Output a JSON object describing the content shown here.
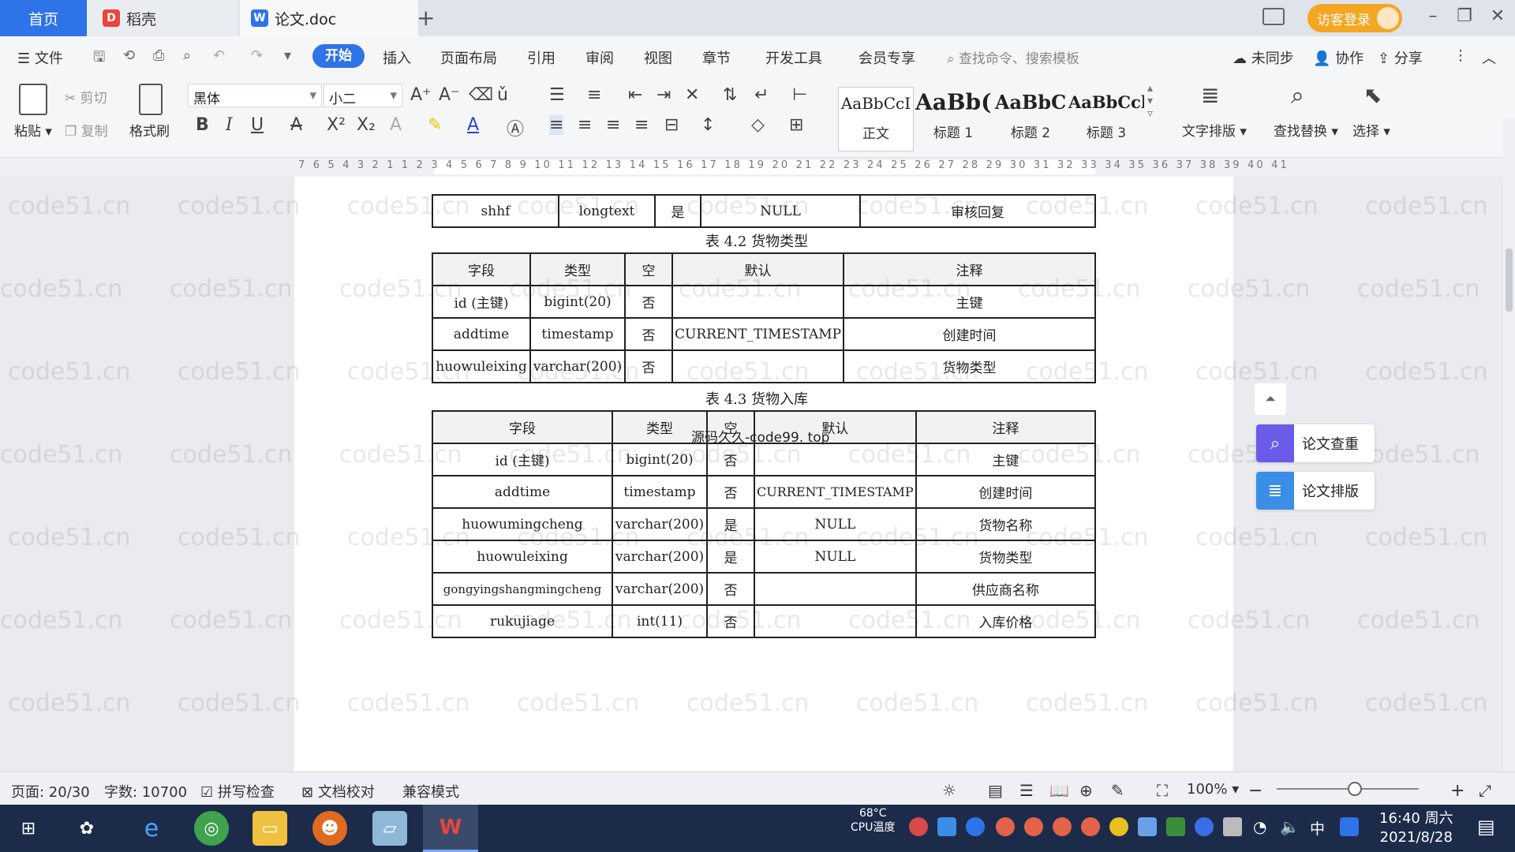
{
  "titlebar": {
    "tabs": [
      {
        "label": "首页"
      },
      {
        "label": "稻壳",
        "icon": "daoke-icon"
      },
      {
        "label": "论文.doc",
        "icon": "wps-writer-icon"
      }
    ],
    "guest_login": "访客登录"
  },
  "menubar": {
    "file": "文件",
    "items": [
      "开始",
      "插入",
      "页面布局",
      "引用",
      "审阅",
      "视图",
      "章节",
      "开发工具",
      "会员专享"
    ],
    "search_placeholder": "查找命令、搜索模板",
    "unsynced": "未同步",
    "collaborate": "协作",
    "share": "分享"
  },
  "ribbon": {
    "paste": "粘贴",
    "cut": "剪切",
    "copy": "复制",
    "format_painter": "格式刷",
    "font_name": "黑体",
    "font_size": "小二",
    "styles": [
      {
        "sample": "AaBbCcI",
        "name": "正文"
      },
      {
        "sample": "AaBb(",
        "name": "标题 1"
      },
      {
        "sample": "AaBbC",
        "name": "标题 2"
      },
      {
        "sample": "AaBbCcl",
        "name": "标题 3"
      }
    ],
    "text_layout": "文字排版",
    "find_replace": "查找替换",
    "select": "选择"
  },
  "ruler": {
    "numbers": "7 6 5 4 3 2 1 1 2 3 4 5 6 7 8 9 10 11 12 13 14 15 16 17 18 19 20 21 22 23 24 25 26 27 28 29 30 31 32 33 34 35 36 37 38 39 40 41"
  },
  "watermark": "code51.cn",
  "overlay_text": "源码久久-code99. top",
  "document": {
    "table1_tail": {
      "row": [
        "shhf",
        "longtext",
        "是",
        "NULL",
        "审核回复"
      ]
    },
    "table2": {
      "caption": "表 4.2  货物类型",
      "header": [
        "字段",
        "类型",
        "空",
        "默认",
        "注释"
      ],
      "rows": [
        [
          "id (主键)",
          "bigint(20)",
          "否",
          "",
          "主键"
        ],
        [
          "addtime",
          "timestamp",
          "否",
          "CURRENT_TIMESTAMP",
          "创建时间"
        ],
        [
          "huowuleixing",
          "varchar(200)",
          "否",
          "",
          "货物类型"
        ]
      ]
    },
    "table3": {
      "caption": "表 4.3  货物入库",
      "header": [
        "字段",
        "类型",
        "空",
        "默认",
        "注释"
      ],
      "rows": [
        [
          "id (主键)",
          "bigint(20)",
          "否",
          "",
          "主键"
        ],
        [
          "addtime",
          "timestamp",
          "否",
          "CURRENT_TIMESTAMP",
          "创建时间"
        ],
        [
          "huowumingcheng",
          "varchar(200)",
          "是",
          "NULL",
          "货物名称"
        ],
        [
          "huowuleixing",
          "varchar(200)",
          "是",
          "NULL",
          "货物类型"
        ],
        [
          "gongyingshangmingcheng",
          "varchar(200)",
          "否",
          "",
          "供应商名称"
        ],
        [
          "rukujiage",
          "int(11)",
          "否",
          "",
          "入库价格"
        ]
      ]
    }
  },
  "side_panel": {
    "check": "论文查重",
    "layout": "论文排版"
  },
  "statusbar": {
    "page": "页面: 20/30",
    "words": "字数: 10700",
    "spell_check": "拼写检查",
    "doc_proof": "文档校对",
    "compat_mode": "兼容模式",
    "zoom": "100%"
  },
  "taskbar": {
    "cpu_temp": "68°C",
    "cpu_label": "CPU温度",
    "ime": "中",
    "time": "16:40 周六",
    "date": "2021/8/28"
  }
}
